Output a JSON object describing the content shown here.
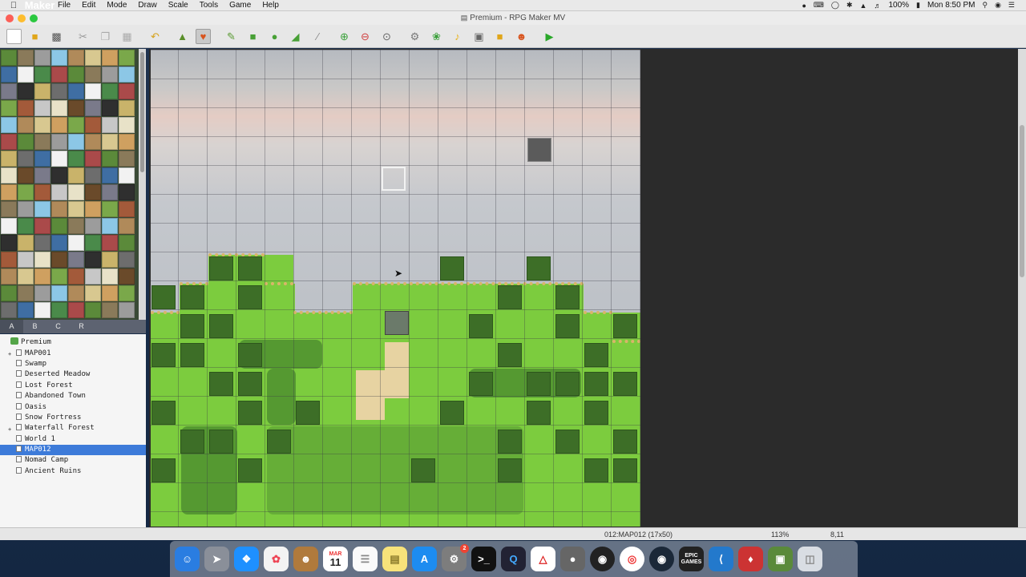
{
  "menubar": {
    "app_name": "RPG Maker MV",
    "items": [
      "File",
      "Edit",
      "Mode",
      "Draw",
      "Scale",
      "Tools",
      "Game",
      "Help"
    ],
    "battery": "100%",
    "clock": "Mon 8:50 PM"
  },
  "window": {
    "title": "Premium - RPG Maker MV"
  },
  "toolbar": {
    "tools": [
      "new-project",
      "open-project",
      "save-project",
      "cut",
      "copy",
      "paste",
      "undo",
      "map-mode",
      "event-mode",
      "pencil",
      "rectangle",
      "ellipse",
      "fill",
      "shadow-pen",
      "zoom-in",
      "zoom-out",
      "actual-size",
      "database",
      "plugin-manager",
      "sound-test",
      "event-searcher",
      "resource-manager",
      "character-generator",
      "playtest"
    ],
    "active_tool": "event-mode"
  },
  "tileset_tabs": [
    "A",
    "B",
    "C",
    "R"
  ],
  "tileset_active_tab": "A",
  "map_tree": {
    "root": "Premium",
    "maps": [
      {
        "name": "MAP001",
        "expandable": true
      },
      {
        "name": "Swamp"
      },
      {
        "name": "Deserted Meadow"
      },
      {
        "name": "Lost Forest"
      },
      {
        "name": "Abandoned Town"
      },
      {
        "name": "Oasis"
      },
      {
        "name": "Snow Fortress"
      },
      {
        "name": "Waterfall Forest",
        "expandable": true
      },
      {
        "name": "World 1"
      },
      {
        "name": "MAP012",
        "selected": true
      },
      {
        "name": "Nomad Camp"
      },
      {
        "name": "Ancient Ruins"
      }
    ]
  },
  "status_bar": {
    "map_info": "012:MAP012 (17x50)",
    "zoom": "113%",
    "coords": "8,11"
  },
  "dock": {
    "apps": [
      "finder-icon",
      "launchpad-icon",
      "safari-icon",
      "photos-icon",
      "contacts-icon",
      "calendar-icon",
      "reminders-icon",
      "notes-icon",
      "app-store-icon",
      "system-preferences-icon",
      "terminal-icon",
      "quicktime-icon",
      "acrobat-icon",
      "gimp-icon",
      "obs-icon",
      "chrome-icon",
      "steam-icon",
      "epic-games-icon",
      "vscode-icon",
      "rpg-maker-icon",
      "preview-icon",
      "trash-icon"
    ],
    "calendar_month": "MAR",
    "calendar_day": "11",
    "epic_label": "EPIC GAMES",
    "sysprefs_badge": "2"
  }
}
